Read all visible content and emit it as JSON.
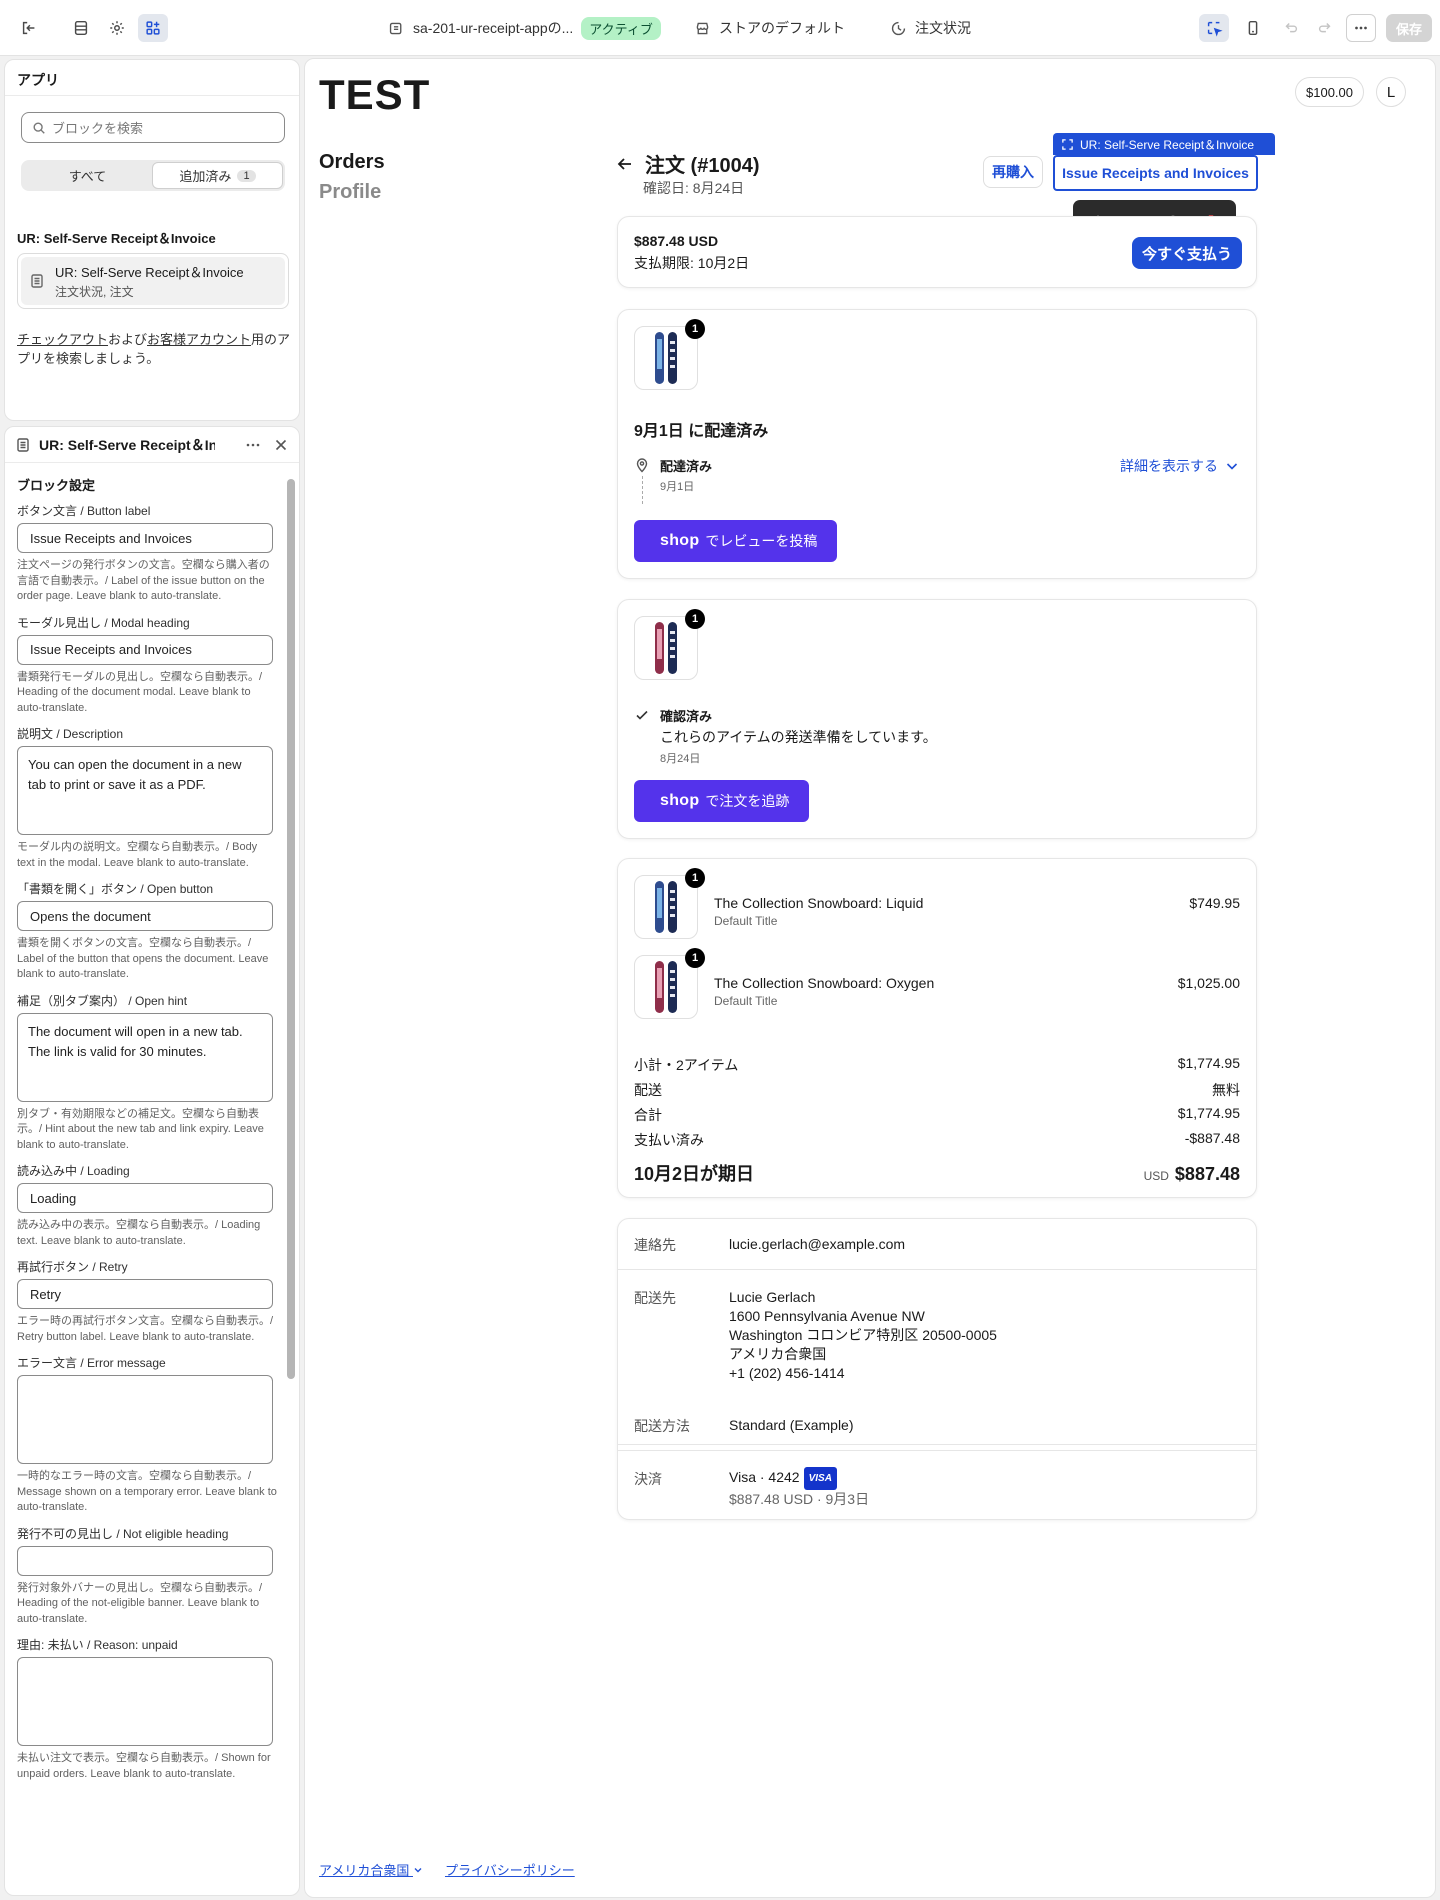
{
  "topbar": {
    "app_name": "sa-201-ur-receipt-appの...",
    "status_badge": "アクティブ",
    "store_label": "ストアのデフォルト",
    "page_label": "注文状況",
    "save_label": "保存"
  },
  "apps_panel": {
    "title": "アプリ",
    "search_placeholder": "ブロックを検索",
    "tab_all": "すべて",
    "tab_added": "追加済み",
    "added_count": "1",
    "section_heading": "UR: Self-Serve Receipt＆Invoice",
    "card_title": "UR: Self-Serve Receipt＆Invoice",
    "card_subtitle": "注文状況, 注文",
    "note_link1": "チェックアウト",
    "note_mid": "および",
    "note_link2": "お客様アカウント",
    "note_tail": "用のアプリを検索しましょう。"
  },
  "block_panel": {
    "title": "UR: Self-Serve Receipt＆Invoice",
    "heading": "ブロック設定",
    "fields": [
      {
        "label": "ボタン文言 / Button label",
        "value": "Issue Receipts and Invoices",
        "help": "注文ページの発行ボタンの文言。空欄なら購入者の言語で自動表示。/ Label of the issue button on the order page. Leave blank to auto-translate."
      },
      {
        "label": "モーダル見出し / Modal heading",
        "value": "Issue Receipts and Invoices",
        "help": "書類発行モーダルの見出し。空欄なら自動表示。/ Heading of the document modal. Leave blank to auto-translate."
      },
      {
        "label": "説明文 / Description",
        "value": "You can open the document in a new tab to print or save it as a PDF.",
        "help": "モーダル内の説明文。空欄なら自動表示。/ Body text in the modal. Leave blank to auto-translate."
      },
      {
        "label": "「書類を開く」ボタン / Open button",
        "value": "Opens the document",
        "help": "書類を開くボタンの文言。空欄なら自動表示。/ Label of the button that opens the document. Leave blank to auto-translate."
      },
      {
        "label": "補足（別タブ案内） / Open hint",
        "value": "The document will open in a new tab. The link is valid for 30 minutes.",
        "help": "別タブ・有効期限などの補足文。空欄なら自動表示。/ Hint about the new tab and link expiry. Leave blank to auto-translate."
      },
      {
        "label": "読み込み中 / Loading",
        "value": "Loading",
        "help": "読み込み中の表示。空欄なら自動表示。/ Loading text. Leave blank to auto-translate."
      },
      {
        "label": "再試行ボタン / Retry",
        "value": "Retry",
        "help": "エラー時の再試行ボタン文言。空欄なら自動表示。/ Retry button label. Leave blank to auto-translate."
      },
      {
        "label": "エラー文言 / Error message",
        "value": "",
        "help": "一時的なエラー時の文言。空欄なら自動表示。/ Message shown on a temporary error. Leave blank to auto-translate."
      },
      {
        "label": "発行不可の見出し / Not eligible heading",
        "value": "",
        "help": "発行対象外バナーの見出し。空欄なら自動表示。/ Heading of the not-eligible banner. Leave blank to auto-translate."
      },
      {
        "label": "理由: 未払い / Reason: unpaid",
        "value": "",
        "help": "未払い注文で表示。空欄なら自動表示。/ Shown for unpaid orders. Leave blank to auto-translate."
      }
    ]
  },
  "preview": {
    "logo": "TEST",
    "balance": "$100.00",
    "avatar_initial": "L",
    "nav_orders": "Orders",
    "nav_profile": "Profile",
    "order_title": "注文 (#1004)",
    "order_confirmed": "確認日: 8月24日",
    "rebuy_label": "再購入",
    "issue_label": "Issue Receipts and Invoices",
    "selection_tag": "UR: Self-Serve Receipt＆Invoice",
    "payment": {
      "amount": "$887.48 USD",
      "due": "支払期限: 10月2日",
      "pay_button": "今すぐ支払う"
    },
    "shipment1": {
      "qty": "1",
      "heading": "9月1日 に配達済み",
      "status": "配達済み",
      "date": "9月1日",
      "detail_link": "詳細を表示する",
      "shop_word": "shop",
      "shop_label": "でレビューを投稿"
    },
    "shipment2": {
      "qty": "1",
      "status": "確認済み",
      "desc": "これらのアイテムの発送準備をしています。",
      "date": "8月24日",
      "shop_word": "shop",
      "shop_label": "で注文を追跡"
    },
    "line_items": [
      {
        "qty": "1",
        "name": "The Collection Snowboard: Liquid",
        "variant": "Default Title",
        "price": "$749.95"
      },
      {
        "qty": "1",
        "name": "The Collection Snowboard: Oxygen",
        "variant": "Default Title",
        "price": "$1,025.00"
      }
    ],
    "summary": [
      {
        "label": "小計・2アイテム",
        "value": "$1,774.95"
      },
      {
        "label": "配送",
        "value": "無料"
      },
      {
        "label": "合計",
        "value": "$1,774.95"
      },
      {
        "label": "支払い済み",
        "value": "-$887.48"
      }
    ],
    "due_label": "10月2日が期日",
    "due_currency": "USD",
    "due_value": "$887.48",
    "info": {
      "contact_label": "連絡先",
      "contact_value": "lucie.gerlach@example.com",
      "ship_label": "配送先",
      "ship_lines": [
        "Lucie Gerlach",
        "1600 Pennsylvania Avenue NW",
        "Washington コロンビア特別区 20500-0005",
        "アメリカ合衆国",
        "+1 (202) 456-1414"
      ],
      "method_label": "配送方法",
      "method_value": "Standard (Example)",
      "pay_label": "決済",
      "pay_value": "Visa · 4242",
      "visa_badge": "VISA",
      "pay_sub": "$887.48 USD · 9月3日"
    },
    "footer_country": "アメリカ合衆国",
    "footer_privacy": "プライバシーポリシー"
  }
}
